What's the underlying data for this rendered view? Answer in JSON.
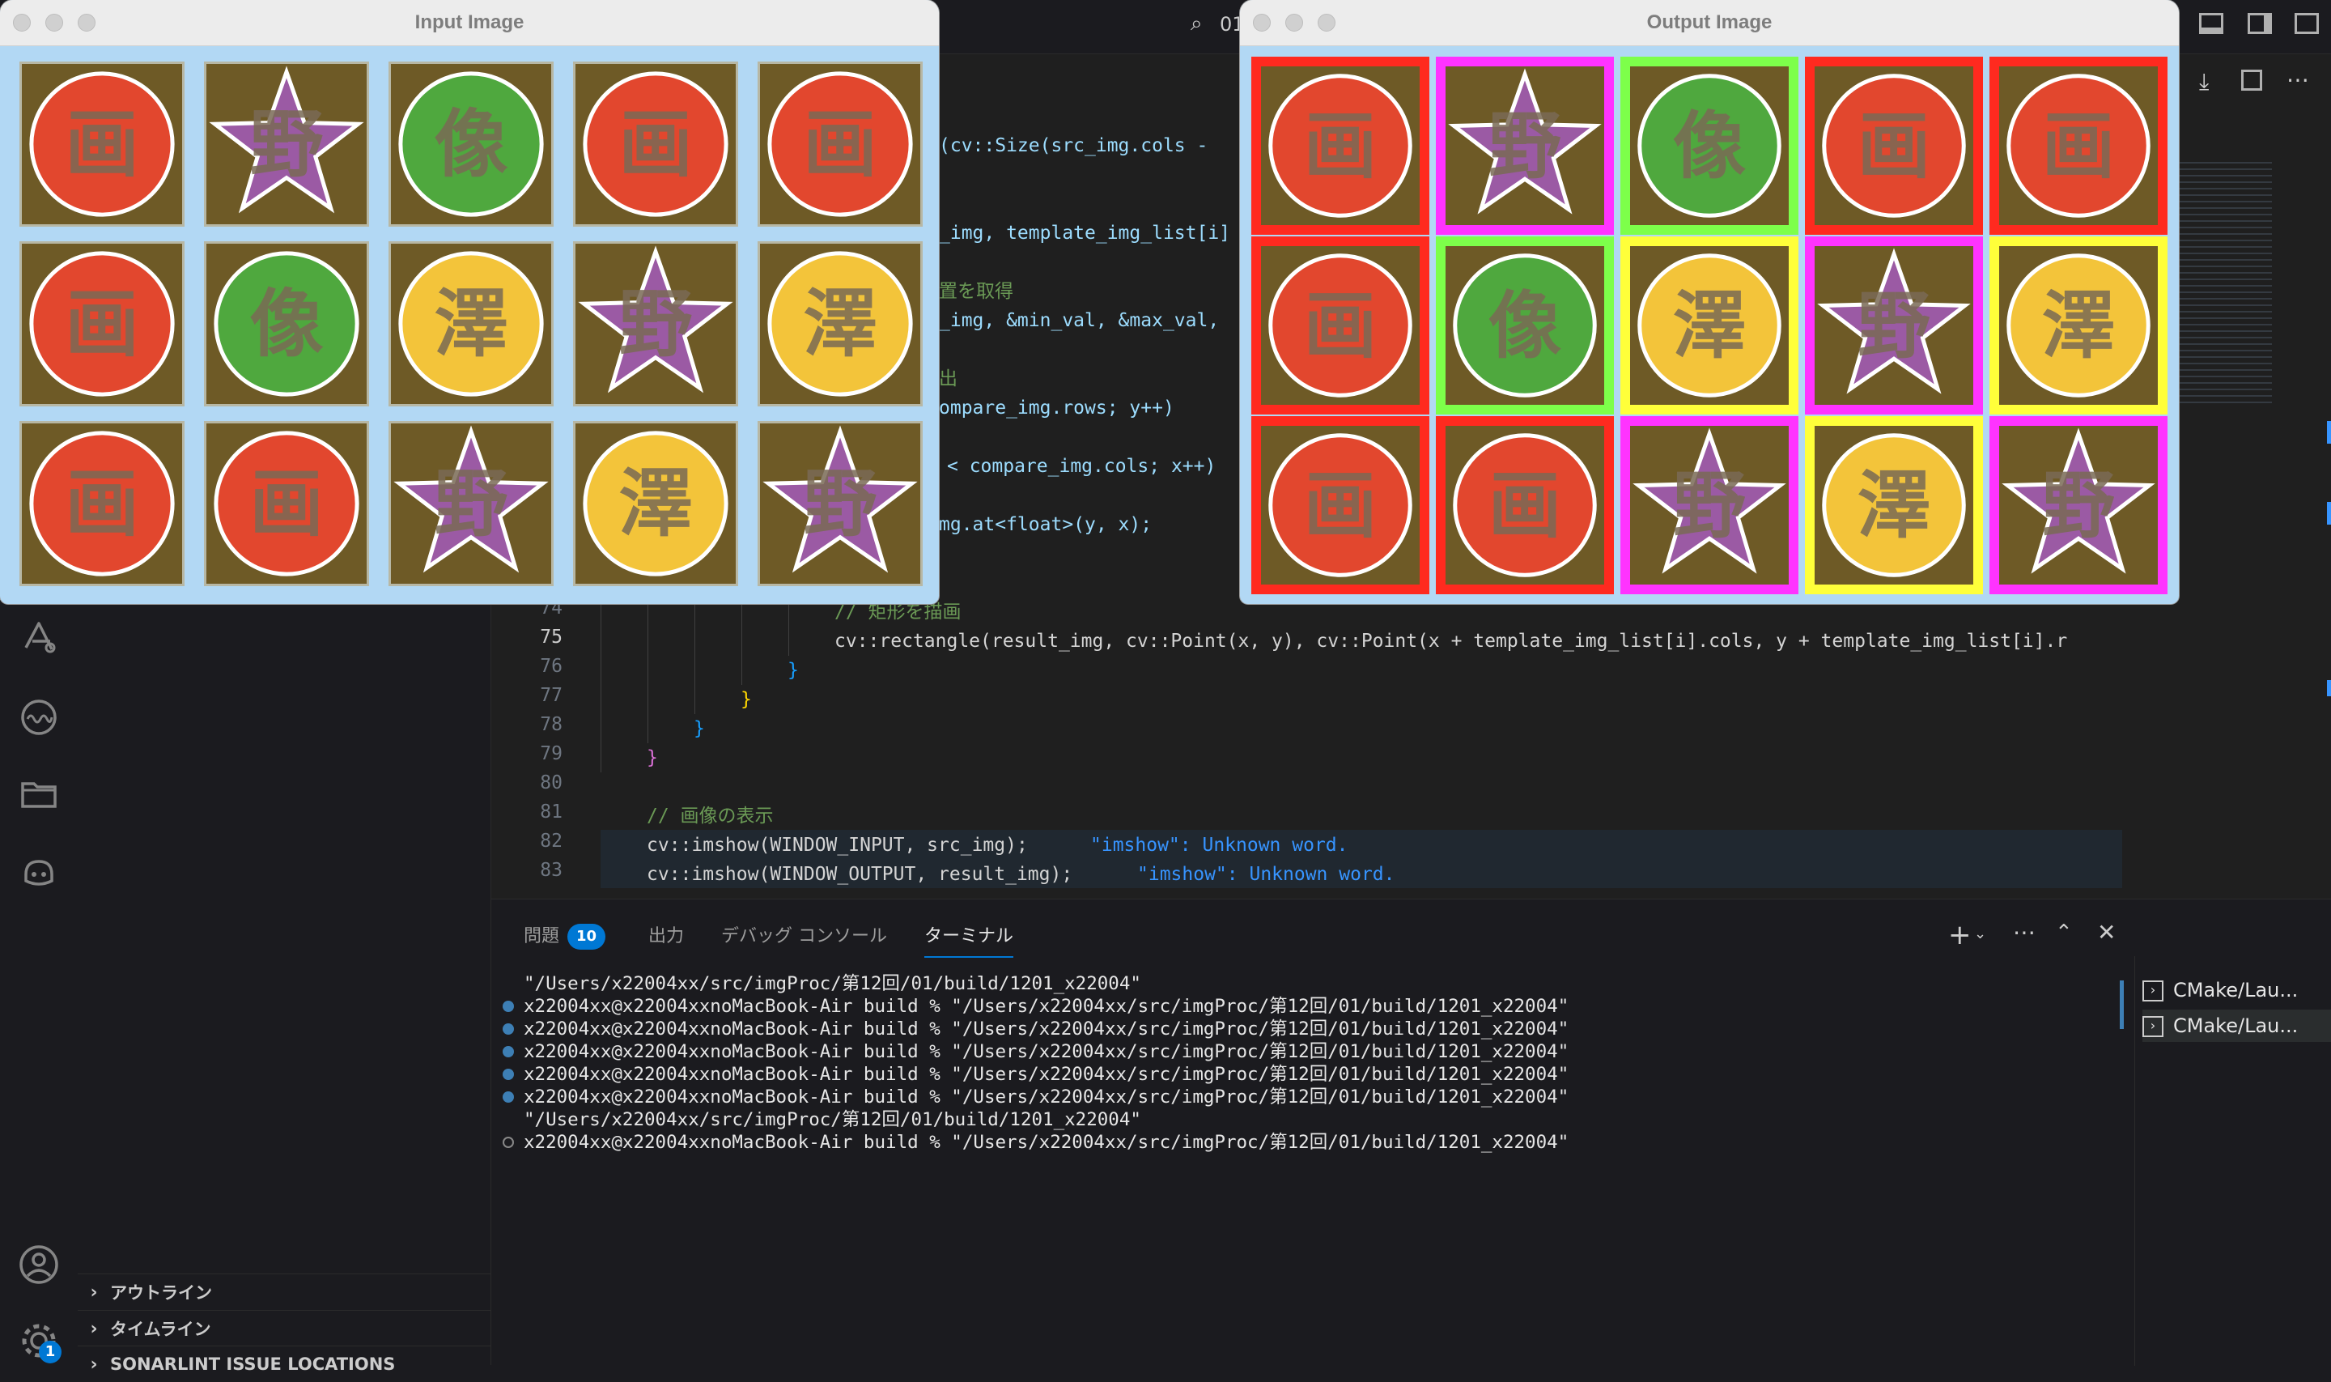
{
  "windows": {
    "input": {
      "title": "Input Image"
    },
    "output": {
      "title": "Output Image"
    }
  },
  "grid": {
    "rows": [
      [
        "circle-red",
        "star-purple",
        "circle-green",
        "circle-red",
        "circle-red"
      ],
      [
        "circle-red",
        "circle-green",
        "circle-yellow",
        "star-purple",
        "circle-yellow"
      ],
      [
        "circle-red",
        "circle-red",
        "star-purple",
        "circle-yellow",
        "star-purple"
      ]
    ],
    "glyphs": {
      "circle-red": "画",
      "circle-green": "像",
      "circle-yellow": "澤",
      "star-purple": "野"
    },
    "fills": {
      "circle-red": "#e2472e",
      "circle-green": "#4fa83e",
      "circle-yellow": "#f3c43a",
      "star-purple": "#9b5aa4"
    },
    "match_frame_colors": {
      "circle-red": "#ff2a1f",
      "circle-green": "#7dff4a",
      "circle-yellow": "#ffff3a",
      "star-purple": "#ff33ff"
    }
  },
  "editor": {
    "search_hint": "01",
    "lines": [
      {
        "n": "74",
        "text": "// 矩形を描画"
      },
      {
        "n": "75",
        "text": "cv::rectangle(result_img, cv::Point(x, y), cv::Point(x + template_img_list[i].cols, y + template_img_list[i].r"
      },
      {
        "n": "76",
        "text": "}"
      },
      {
        "n": "77",
        "text": "}"
      },
      {
        "n": "78",
        "text": "}"
      },
      {
        "n": "79",
        "text": "}"
      },
      {
        "n": "80",
        "text": ""
      },
      {
        "n": "81",
        "text": "// 画像の表示"
      },
      {
        "n": "82",
        "text": "cv::imshow(WINDOW_INPUT, src_img);"
      },
      {
        "n": "83",
        "text": "cv::imshow(WINDOW_OUTPUT, result_img);"
      }
    ],
    "partial_lines": [
      "(cv::Size(src_img.cols -",
      "_img, template_img_list[i]",
      "置を取得",
      "_img, &min_val, &max_val,",
      "出",
      "ompare_img.rows; y++)",
      "< compare_img.cols; x++)",
      "mg.at<float>(y, x);"
    ],
    "diagnostics": {
      "line82": "\"imshow\": Unknown word.",
      "line83": "\"imshow\": Unknown word."
    }
  },
  "panel": {
    "tabs": {
      "problems": "問題",
      "problems_count": "10",
      "output": "出力",
      "debug_console": "デバッグ コンソール",
      "terminal": "ターミナル"
    },
    "terminal_lines": [
      {
        "marker": "none",
        "text": "\"/Users/x22004xx/src/imgProc/第12回/01/build/1201_x22004\""
      },
      {
        "marker": "filled",
        "text": "x22004xx@x22004xxnoMacBook-Air build % \"/Users/x22004xx/src/imgProc/第12回/01/build/1201_x22004\""
      },
      {
        "marker": "filled",
        "text": "x22004xx@x22004xxnoMacBook-Air build % \"/Users/x22004xx/src/imgProc/第12回/01/build/1201_x22004\""
      },
      {
        "marker": "filled",
        "text": "x22004xx@x22004xxnoMacBook-Air build % \"/Users/x22004xx/src/imgProc/第12回/01/build/1201_x22004\""
      },
      {
        "marker": "filled",
        "text": "x22004xx@x22004xxnoMacBook-Air build % \"/Users/x22004xx/src/imgProc/第12回/01/build/1201_x22004\""
      },
      {
        "marker": "filled",
        "text": "x22004xx@x22004xxnoMacBook-Air build % \"/Users/x22004xx/src/imgProc/第12回/01/build/1201_x22004\""
      },
      {
        "marker": "none",
        "text": "\"/Users/x22004xx/src/imgProc/第12回/01/build/1201_x22004\""
      },
      {
        "marker": "hollow",
        "text": "x22004xx@x22004xxnoMacBook-Air build % \"/Users/x22004xx/src/imgProc/第12回/01/build/1201_x22004\""
      }
    ],
    "terminal_list": [
      "CMake/Lau...",
      "CMake/Lau..."
    ]
  },
  "sidebar": {
    "sections": [
      "アウトライン",
      "タイムライン",
      "SONARLINT ISSUE LOCATIONS"
    ],
    "settings_badge": "1"
  }
}
